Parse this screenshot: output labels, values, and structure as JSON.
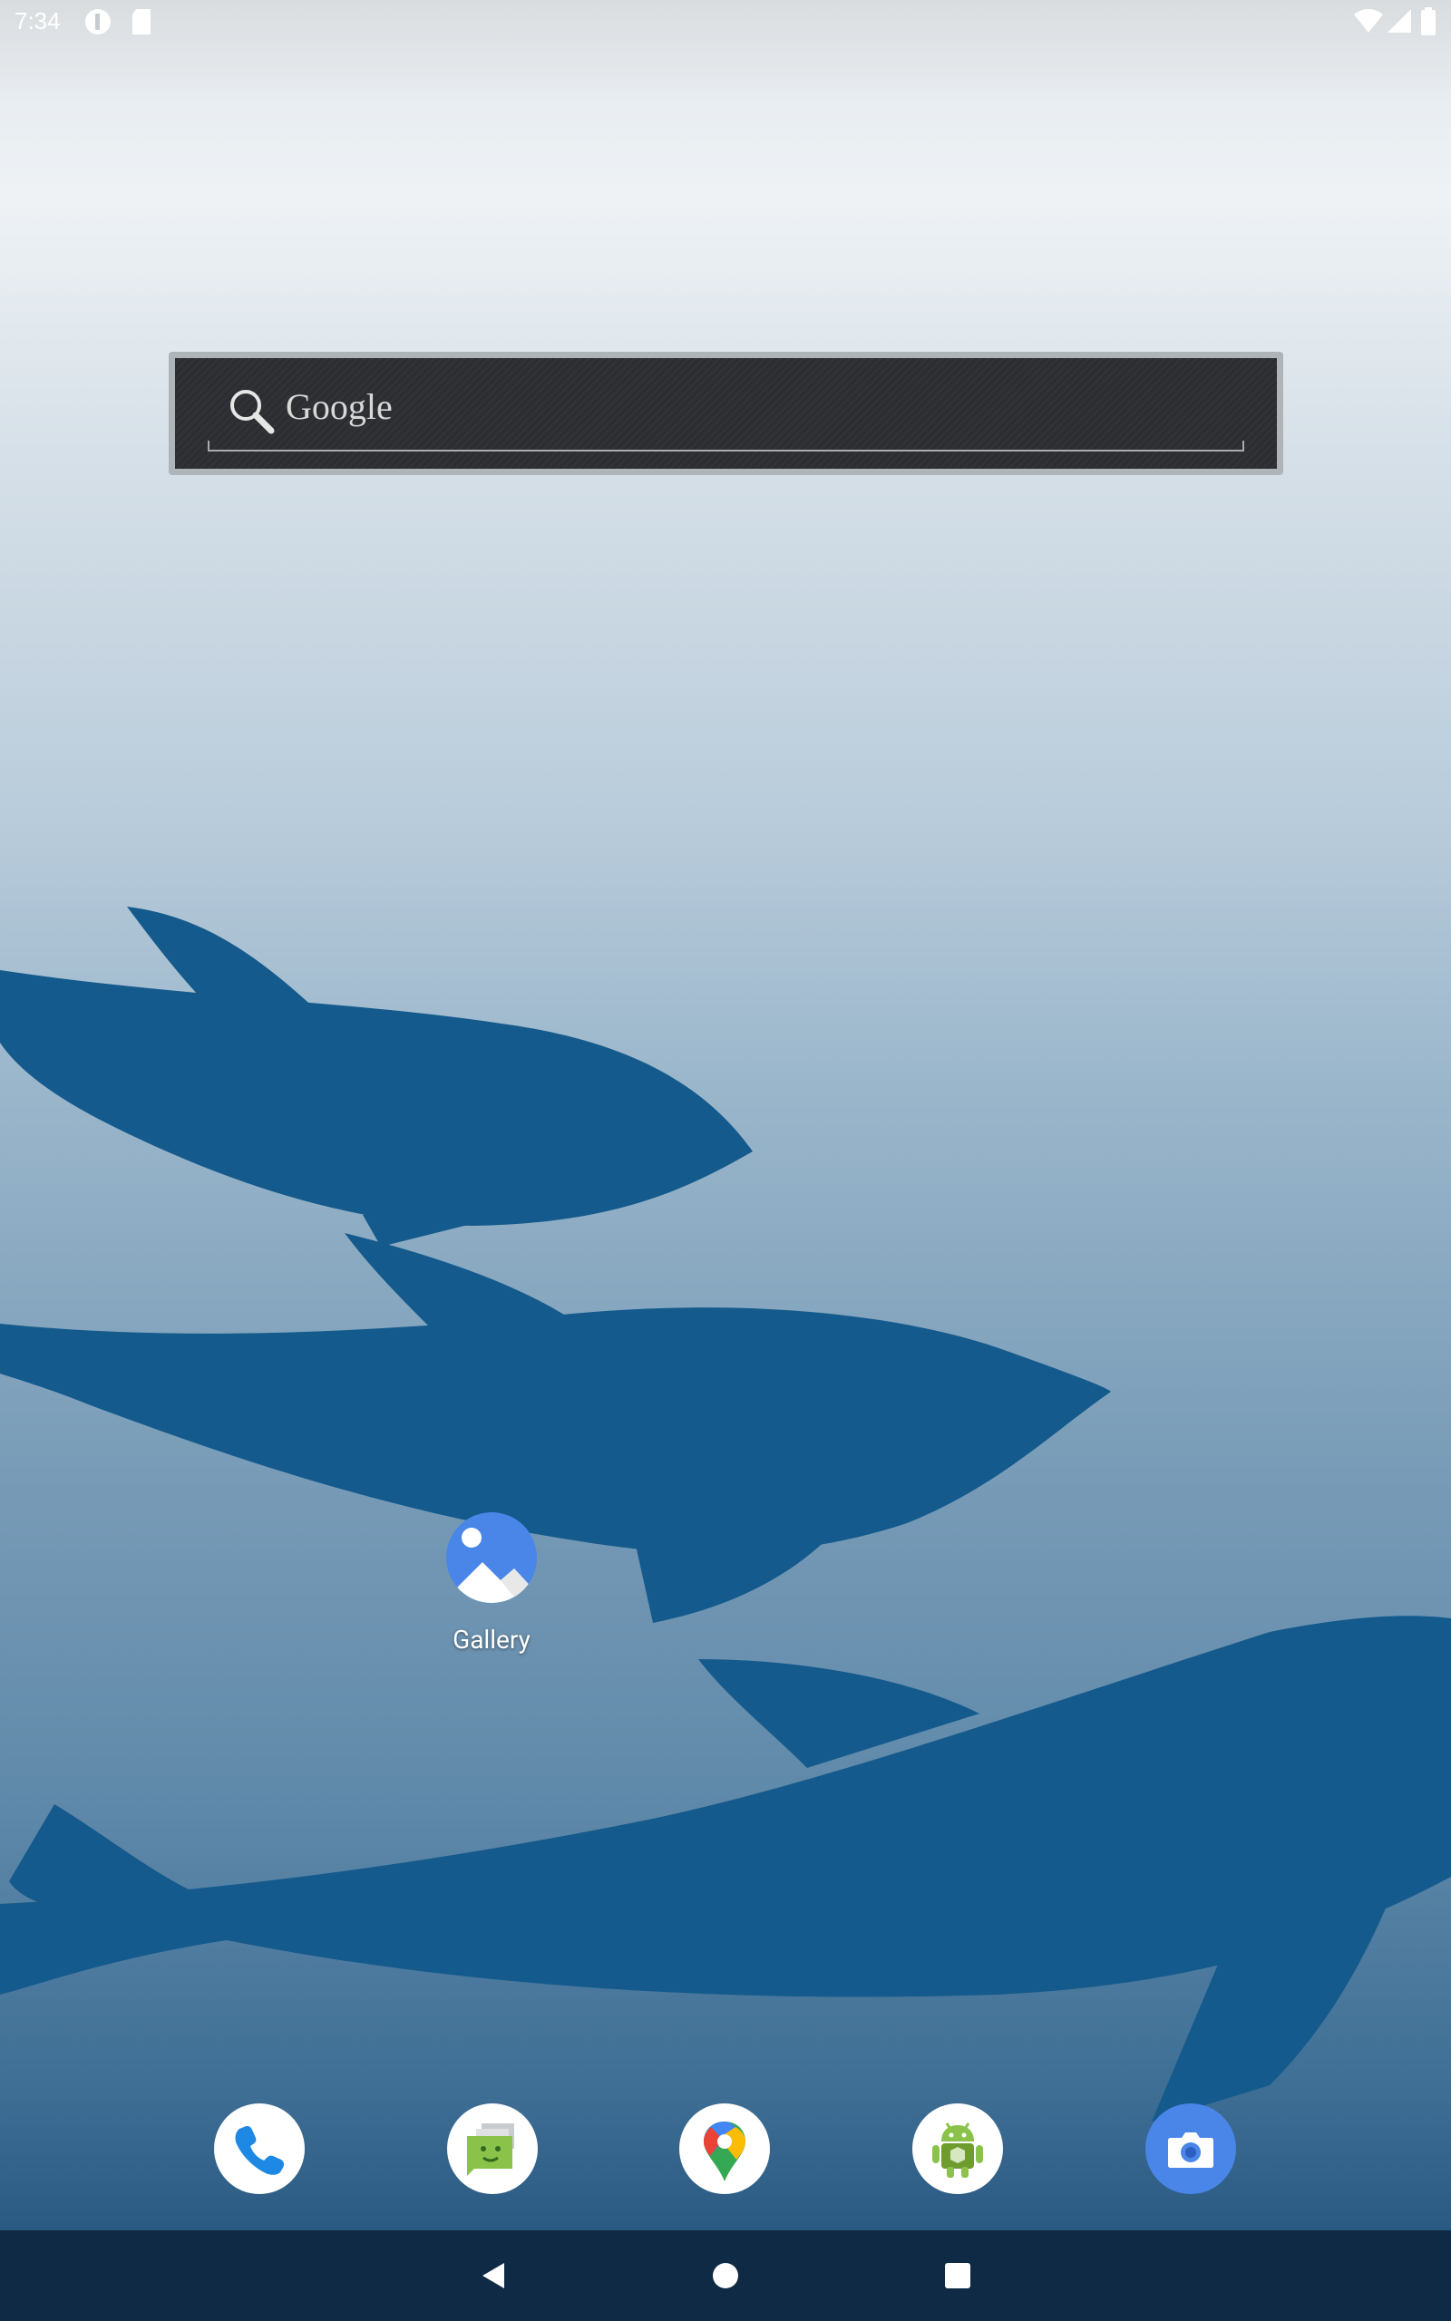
{
  "status_bar": {
    "time": "7:34",
    "left_icons": [
      "data-saver-icon",
      "sd-card-icon"
    ],
    "right_icons": [
      "wifi-icon",
      "cell-signal-icon",
      "battery-icon"
    ]
  },
  "search_widget": {
    "hint": "Google",
    "icon": "search-icon"
  },
  "shortcuts": [
    {
      "label": "Gallery",
      "icon": "gallery-icon"
    }
  ],
  "dock": [
    {
      "name": "Phone",
      "icon": "phone-icon"
    },
    {
      "name": "Messaging",
      "icon": "messaging-icon"
    },
    {
      "name": "Maps",
      "icon": "maps-pin-icon"
    },
    {
      "name": "API Demos",
      "icon": "android-icon"
    },
    {
      "name": "Camera",
      "icon": "camera-icon"
    }
  ],
  "nav_bar": [
    "back-icon",
    "home-icon",
    "recents-icon"
  ],
  "colors": {
    "whale": "#145a8c",
    "nav_bar": "#0e2a45",
    "gallery_blue": "#4285f4"
  }
}
